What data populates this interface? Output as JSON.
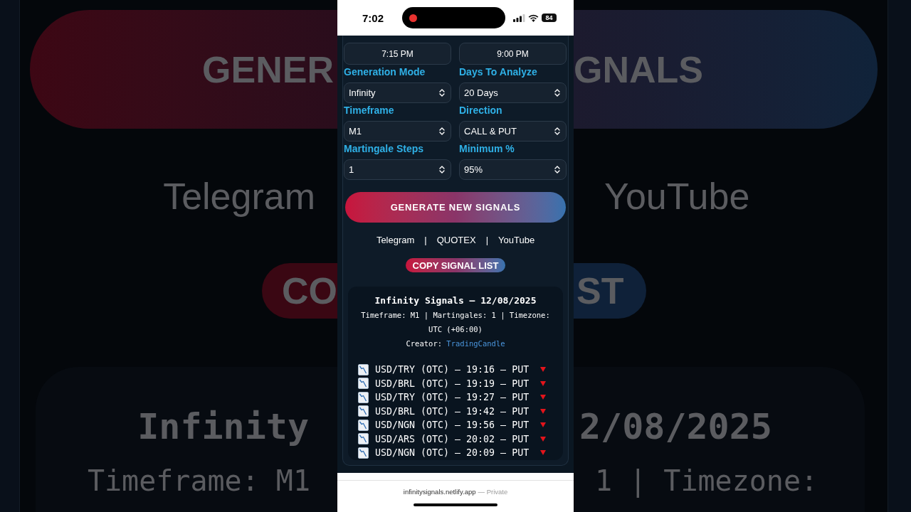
{
  "backdrop": {
    "left": [
      {
        "kind": "button",
        "text": "GENER"
      },
      {
        "kind": "link",
        "text": "Telegram"
      },
      {
        "kind": "pill",
        "text": "CO"
      },
      {
        "kind": "title",
        "text": "Infinity"
      },
      {
        "kind": "meta",
        "text": "Timeframe: M1"
      }
    ],
    "right": [
      {
        "kind": "button",
        "text": "GNALS"
      },
      {
        "kind": "link",
        "text": "YouTube"
      },
      {
        "kind": "pill",
        "text": "ST"
      },
      {
        "kind": "title",
        "text": "2/08/2025"
      },
      {
        "kind": "meta",
        "text": "1 | Timezone:"
      }
    ]
  },
  "status_bar": {
    "time": "7:02",
    "recording": true,
    "battery": "84"
  },
  "time_range": [
    {
      "value": "7:15 PM"
    },
    {
      "value": "9:00 PM"
    }
  ],
  "settings": [
    {
      "label": "Generation Mode",
      "value": "Infinity"
    },
    {
      "label": "Days To Analyze",
      "value": "20 Days"
    },
    {
      "label": "Timeframe",
      "value": "M1"
    },
    {
      "label": "Direction",
      "value": "CALL & PUT"
    },
    {
      "label": "Martingale Steps",
      "value": "1"
    },
    {
      "label": "Minimum %",
      "value": "95%"
    }
  ],
  "generate_button": "GENERATE NEW SIGNALS",
  "links": [
    "Telegram",
    "QUOTEX",
    "YouTube"
  ],
  "link_separators": [
    "|",
    "|"
  ],
  "copy_button": "COPY SIGNAL LIST",
  "signal_card": {
    "title": "Infinity Signals – 12/08/2025",
    "meta": "Timeframe: M1 | Martingales: 1 | Timezone: UTC (+06:00)",
    "creator_label": "Creator:",
    "creator": "TradingCandle",
    "signals": [
      {
        "kind": "put",
        "text": "USD/TRY (OTC) – 19:16 – PUT"
      },
      {
        "kind": "put",
        "text": "USD/BRL (OTC) – 19:19 – PUT"
      },
      {
        "kind": "put",
        "text": "USD/TRY (OTC) – 19:27 – PUT"
      },
      {
        "kind": "put",
        "text": "USD/BRL (OTC) – 19:42 – PUT"
      },
      {
        "kind": "put",
        "text": "USD/NGN (OTC) – 19:56 – PUT"
      },
      {
        "kind": "put",
        "text": "USD/ARS (OTC) – 20:02 – PUT"
      },
      {
        "kind": "put",
        "text": "USD/NGN (OTC) – 20:09 – PUT"
      }
    ]
  },
  "address_bar": {
    "url": "infinitysignals.netlify.app",
    "note": "— Private"
  }
}
